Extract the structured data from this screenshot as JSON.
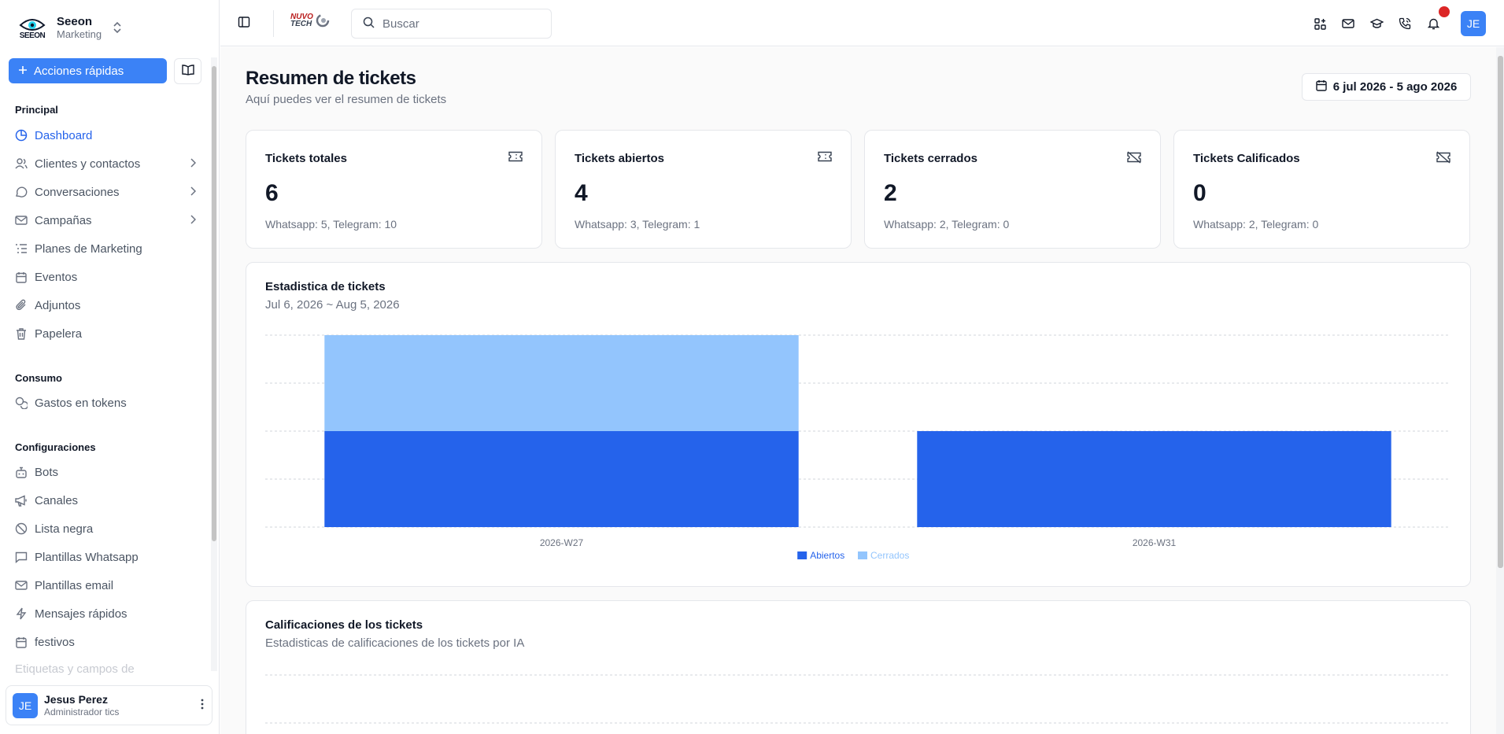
{
  "sidebar": {
    "brand": {
      "logo_text": "SEEON",
      "name": "Seeon",
      "sub": "Marketing"
    },
    "quick_actions": "Acciones rápidas",
    "sections": {
      "principal": "Principal",
      "consumo": "Consumo",
      "config": "Configuraciones"
    },
    "items": [
      {
        "label": "Dashboard",
        "icon": "pie-chart-icon"
      },
      {
        "label": "Clientes y contactos",
        "icon": "users-icon"
      },
      {
        "label": "Conversaciones",
        "icon": "message-icon"
      },
      {
        "label": "Campañas",
        "icon": "mail-icon"
      },
      {
        "label": "Planes de Marketing",
        "icon": "list-icon"
      },
      {
        "label": "Eventos",
        "icon": "calendar-icon"
      },
      {
        "label": "Adjuntos",
        "icon": "paperclip-icon"
      },
      {
        "label": "Papelera",
        "icon": "trash-icon"
      },
      {
        "label": "Gastos en tokens",
        "icon": "coins-icon"
      },
      {
        "label": "Bots",
        "icon": "bot-icon"
      },
      {
        "label": "Canales",
        "icon": "megaphone-icon"
      },
      {
        "label": "Lista negra",
        "icon": "ban-icon"
      },
      {
        "label": "Plantillas Whatsapp",
        "icon": "message-icon"
      },
      {
        "label": "Plantillas email",
        "icon": "mail-icon"
      },
      {
        "label": "Mensajes rápidos",
        "icon": "zap-icon"
      },
      {
        "label": "festivos",
        "icon": "calendar-icon"
      }
    ],
    "faded_item": "Etiquetas y campos de",
    "user": {
      "initials": "JE",
      "name": "Jesus Perez",
      "role": "Administrador tics"
    }
  },
  "topbar": {
    "partner_logo": {
      "line1": "NUVO",
      "line2": "TECH"
    },
    "search_placeholder": "Buscar",
    "avatar_initials": "JE",
    "icons": [
      "apps-icon",
      "mail-icon",
      "graduation-cap-icon",
      "phone-icon",
      "bell-icon"
    ]
  },
  "page": {
    "title": "Resumen de tickets",
    "subtitle": "Aquí puedes ver el resumen de tickets",
    "date_range": "6 jul 2026 - 5 ago 2026"
  },
  "stats": [
    {
      "title": "Tickets totales",
      "value": "6",
      "detail": "Whatsapp: 5, Telegram: 10",
      "icon": "ticket-icon"
    },
    {
      "title": "Tickets abiertos",
      "value": "4",
      "detail": "Whatsapp: 3, Telegram: 1",
      "icon": "ticket-icon"
    },
    {
      "title": "Tickets cerrados",
      "value": "2",
      "detail": "Whatsapp: 2, Telegram: 0",
      "icon": "ticket-off-icon"
    },
    {
      "title": "Tickets Calificados",
      "value": "0",
      "detail": "Whatsapp: 2, Telegram: 0",
      "icon": "ticket-off-icon"
    }
  ],
  "ticket_chart": {
    "title": "Estadistica de tickets",
    "subtitle": "Jul 6, 2026 ~ Aug 5, 2026"
  },
  "ratings_panel": {
    "title": "Calificaciones de los tickets",
    "subtitle": "Estadisticas de calificaciones de los tickets por IA"
  },
  "chart_data": {
    "type": "bar",
    "stacked": true,
    "categories": [
      "2026-W27",
      "2026-W31"
    ],
    "series": [
      {
        "name": "Abiertos",
        "color": "#2563eb",
        "values": [
          2,
          2
        ]
      },
      {
        "name": "Cerrados",
        "color": "#93c5fd",
        "values": [
          2,
          0
        ]
      }
    ],
    "ylim": [
      0,
      4
    ],
    "grid": true,
    "legend": "bottom"
  },
  "colors": {
    "accent": "#3b82f6",
    "notification": "#dc2626"
  }
}
